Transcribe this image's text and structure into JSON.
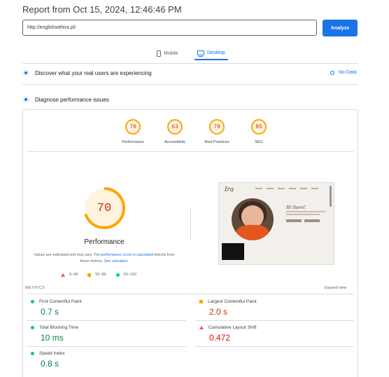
{
  "header": {
    "title": "Report from Oct 15, 2024, 12:46:46 PM"
  },
  "url_form": {
    "value": "http://englishwithira.pl/",
    "analyze_label": "Analyze"
  },
  "device_tabs": [
    {
      "label": "Mobile",
      "active": false
    },
    {
      "label": "Desktop",
      "active": true
    }
  ],
  "sections": {
    "real_users": "Discover what your real users are experiencing",
    "no_data": "No Data",
    "diagnose": "Diagnose performance issues"
  },
  "categories": [
    {
      "label": "Performance",
      "score": "70"
    },
    {
      "label": "Accessibility",
      "score": "63"
    },
    {
      "label": "Best Practices",
      "score": "79"
    },
    {
      "label": "SEO",
      "score": "85"
    }
  ],
  "performance": {
    "score": "70",
    "score_fraction": 0.7,
    "title": "Performance",
    "note_1": "Values are estimated and may vary. The ",
    "note_link_1": "performance score is calculated",
    "note_2": " directly from these metrics. ",
    "note_link_2": "See calculator."
  },
  "legend": [
    {
      "label": "0–49"
    },
    {
      "label": "50–89"
    },
    {
      "label": "90–100"
    }
  ],
  "metrics_header": "METRICS",
  "expand_view": "Expand view",
  "metrics": [
    {
      "label": "First Contentful Paint",
      "value": "0.7 s",
      "rating": "good"
    },
    {
      "label": "Largest Contentful Paint",
      "value": "2.0 s",
      "rating": "average"
    },
    {
      "label": "Total Blocking Time",
      "value": "10 ms",
      "rating": "good"
    },
    {
      "label": "Cumulative Layout Shift",
      "value": "0.472",
      "rating": "poor"
    },
    {
      "label": "Speed Index",
      "value": "0.8 s",
      "rating": "good"
    }
  ],
  "screenshot": {
    "hello_text": "Hi there!"
  },
  "colors": {
    "accent": "#1a73e8",
    "good": "#0cce6b",
    "average": "#ffa400",
    "poor": "#ff4e42"
  }
}
